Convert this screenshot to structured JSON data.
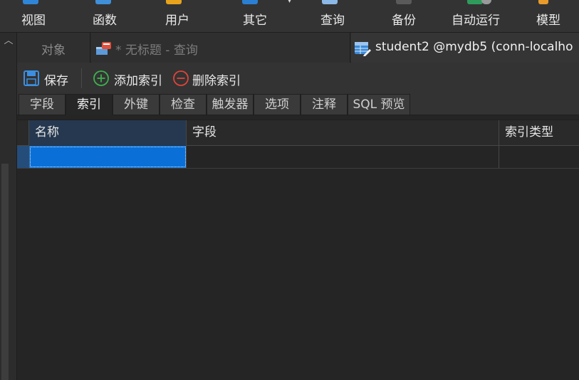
{
  "main_toolbar": {
    "items": [
      {
        "label": "视图",
        "icon": "view-icon"
      },
      {
        "label": "函数",
        "icon": "function-icon"
      },
      {
        "label": "用户",
        "icon": "user-icon"
      },
      {
        "label": "其它",
        "icon": "other-icon"
      },
      {
        "label": "查询",
        "icon": "query-icon"
      },
      {
        "label": "备份",
        "icon": "backup-icon"
      },
      {
        "label": "自动运行",
        "icon": "automation-icon"
      },
      {
        "label": "模型",
        "icon": "model-icon"
      }
    ]
  },
  "tabs": {
    "objects": "对象",
    "query": "* 无标题 - 查询",
    "table": "student2 @mydb5 (conn-localho"
  },
  "actions": {
    "save": "保存",
    "add_index": "添加索引",
    "delete_index": "删除索引"
  },
  "sub_tabs": [
    "字段",
    "索引",
    "外键",
    "检查",
    "触发器",
    "选项",
    "注释",
    "SQL 预览"
  ],
  "active_sub_tab": "索引",
  "grid": {
    "columns": [
      "名称",
      "字段",
      "索引类型"
    ],
    "rows": [
      [
        "",
        "",
        ""
      ]
    ]
  },
  "colors": {
    "accent": "#0a70d8",
    "background": "#252525",
    "toolbar": "#333333"
  }
}
